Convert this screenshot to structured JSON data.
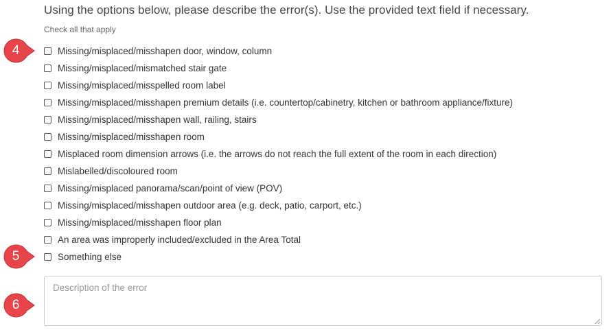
{
  "form": {
    "heading": "Using the options below, please describe the error(s). Use the provided text field if necessary.",
    "hint": "Check all that apply",
    "options": [
      {
        "label": "Missing/misplaced/misshapen door, window, column",
        "checked": false
      },
      {
        "label": "Missing/misplaced/mismatched stair gate",
        "checked": false
      },
      {
        "label": "Missing/misplaced/misspelled room label",
        "checked": false
      },
      {
        "label": "Missing/misplaced/misshapen premium details (i.e. countertop/cabinetry, kitchen or bathroom appliance/fixture)",
        "checked": false
      },
      {
        "label": "Missing/misplaced/misshapen wall, railing, stairs",
        "checked": false
      },
      {
        "label": "Missing/misplaced/misshapen room",
        "checked": false
      },
      {
        "label": "Misplaced room dimension arrows (i.e. the arrows do not reach the full extent of the room in each direction)",
        "checked": false
      },
      {
        "label": "Mislabelled/discoloured room",
        "checked": false
      },
      {
        "label": "Missing/misplaced panorama/scan/point of view (POV)",
        "checked": false
      },
      {
        "label": "Missing/misplaced/misshapen outdoor area (e.g. deck, patio, carport, etc.)",
        "checked": false
      },
      {
        "label": "Missing/misplaced/misshapen floor plan",
        "checked": false
      },
      {
        "label": "An area was improperly included/excluded in the Area Total",
        "checked": false
      },
      {
        "label": "Something else",
        "checked": false
      }
    ],
    "description": {
      "value": "",
      "placeholder": "Description of the error"
    }
  },
  "markers": [
    {
      "number": "4"
    },
    {
      "number": "5"
    },
    {
      "number": "6"
    }
  ],
  "colors": {
    "marker": "#e8454b",
    "checkbox_border": "#555555",
    "text": "#333333"
  }
}
